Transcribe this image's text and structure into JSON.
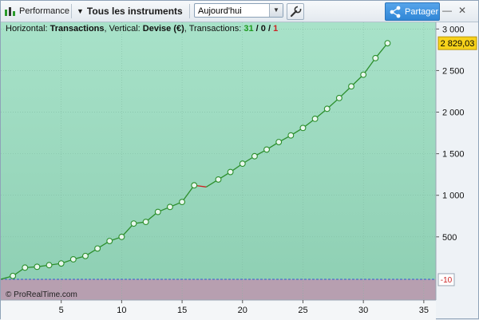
{
  "toolbar": {
    "performance_label": "Performance",
    "instruments_label": "Tous les instruments",
    "period_value": "Aujourd'hui",
    "share_label": "Partager"
  },
  "header": {
    "horizontal_prefix": "Horizontal: ",
    "horizontal_value": "Transactions",
    "vertical_prefix": ", Vertical: ",
    "vertical_value": "Devise (€)",
    "transactions_prefix": ", Transactions: ",
    "won": "31",
    "sep1": " / ",
    "neutral": "0",
    "sep2": " / ",
    "lost": "1"
  },
  "footer": {
    "copyright": "© ProRealTime.com"
  },
  "colors": {
    "accent_green": "#2ca02c",
    "loss_red": "#cc2222",
    "price_tag": "#f7d21a",
    "share_blue": "#3a8fdc"
  },
  "chart_data": {
    "type": "line",
    "x": [
      0,
      1,
      2,
      3,
      4,
      5,
      6,
      7,
      8,
      9,
      10,
      11,
      12,
      13,
      14,
      15,
      16,
      17,
      18,
      19,
      20,
      21,
      22,
      23,
      24,
      25,
      26,
      27,
      28,
      29,
      30,
      31,
      32
    ],
    "values": [
      -10,
      30,
      130,
      140,
      160,
      180,
      230,
      270,
      360,
      450,
      500,
      660,
      680,
      800,
      860,
      920,
      1120,
      1100,
      1190,
      1280,
      1380,
      1470,
      1550,
      1640,
      1720,
      1810,
      1920,
      2040,
      2170,
      2310,
      2450,
      2650,
      2829
    ],
    "loss_segments": [
      [
        16,
        17
      ]
    ],
    "baseline": -10,
    "last_value_label": "2 829,03",
    "baseline_label": "-10",
    "xlim": [
      0,
      36
    ],
    "ylim": [
      -260,
      3080
    ],
    "xticks": [
      5,
      10,
      15,
      20,
      25,
      30,
      35
    ],
    "yticks": [
      500,
      1000,
      1500,
      2000,
      2500,
      3000
    ],
    "ytick_labels": [
      "500",
      "1 000",
      "1 500",
      "2 000",
      "2 500",
      "3 000"
    ],
    "grid": true
  }
}
